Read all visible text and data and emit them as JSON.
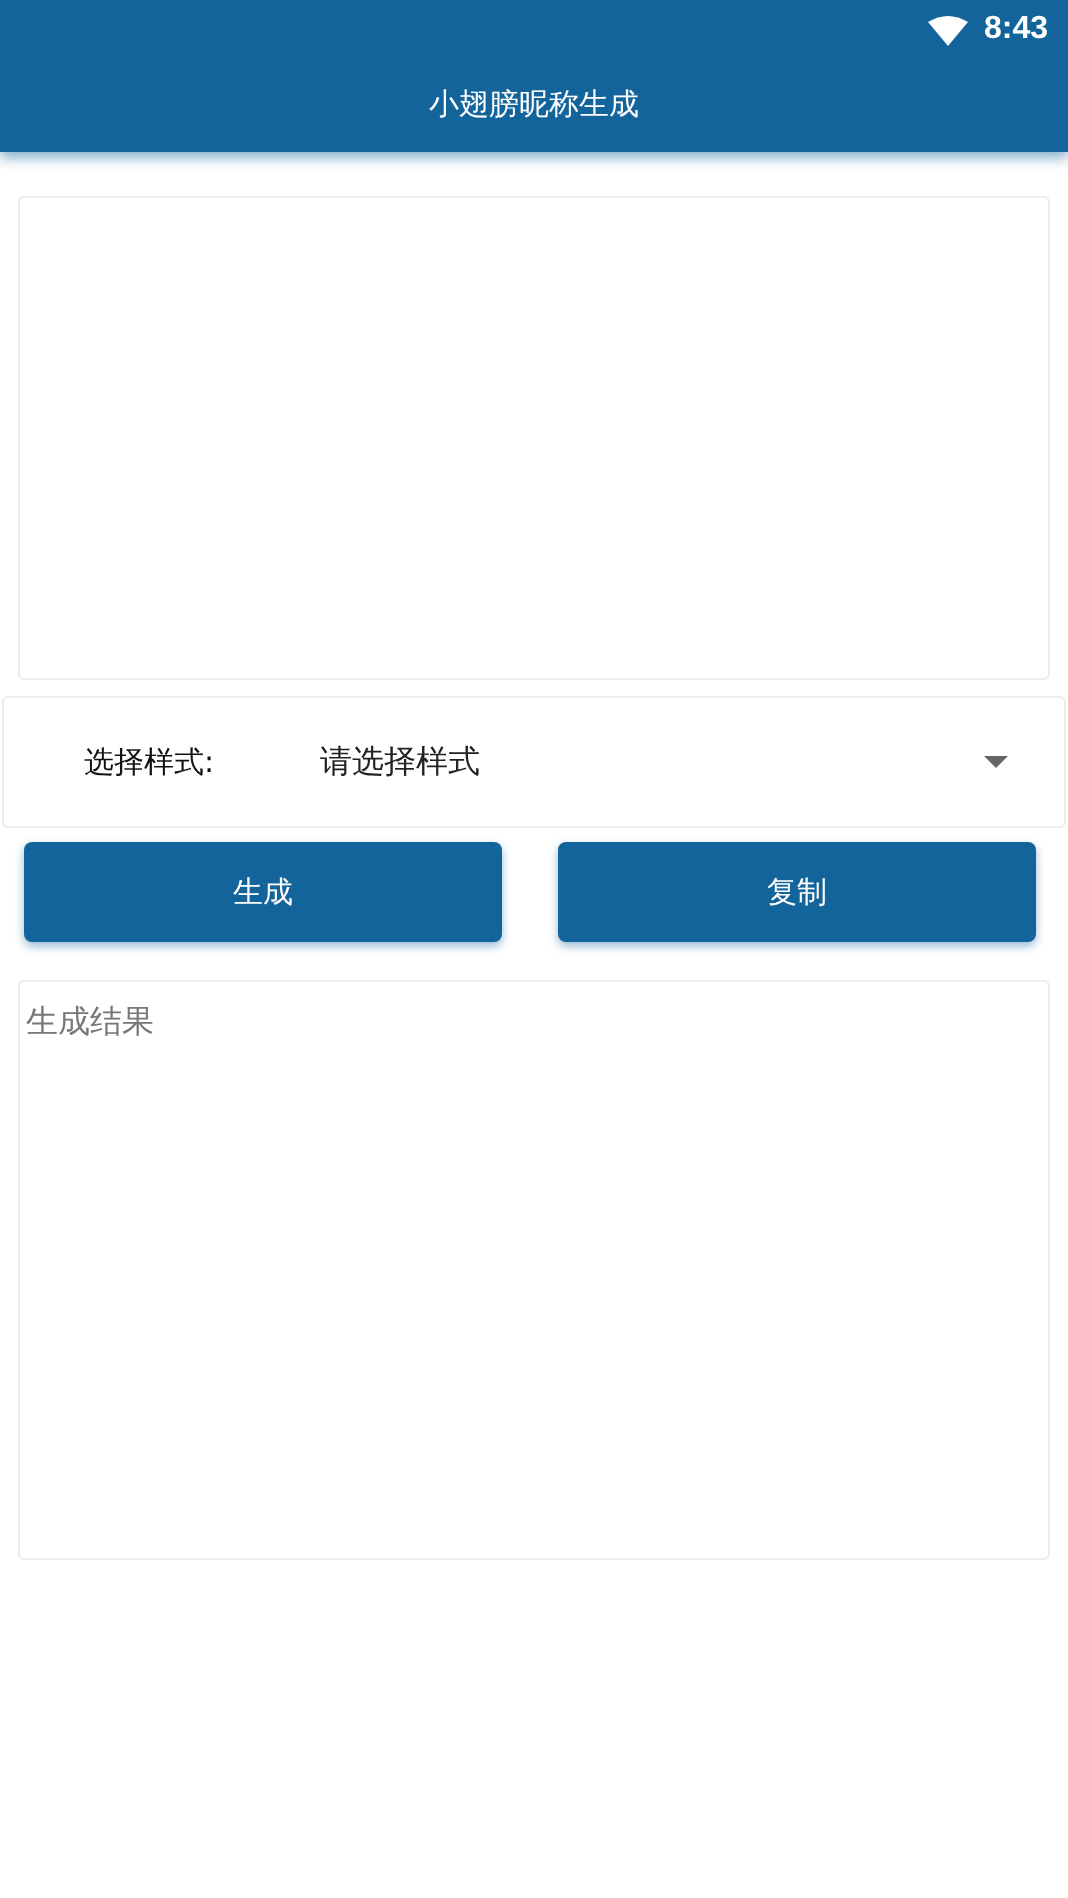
{
  "status_bar": {
    "time": "8:43"
  },
  "app_bar": {
    "title": "小翅膀昵称生成"
  },
  "style_picker": {
    "label": "选择样式:",
    "value": "请选择样式"
  },
  "buttons": [
    {
      "label": "生成"
    },
    {
      "label": "复制"
    }
  ],
  "result": {
    "placeholder": "生成结果"
  }
}
